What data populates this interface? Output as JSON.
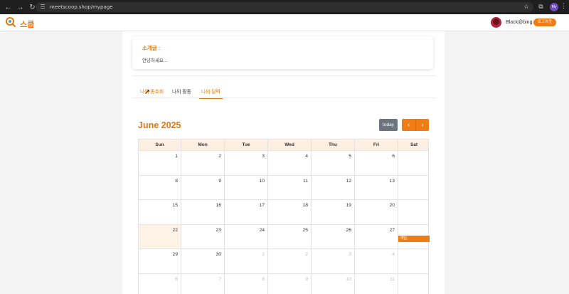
{
  "browser": {
    "url": "meetscoop.shop/mypage",
    "profile_initials": "My"
  },
  "header": {
    "logo_text": "스쿱",
    "username": "Black@bing",
    "logout_label": "로그아웃"
  },
  "intro": {
    "label": "소개글 :",
    "text": "안녕하세요..."
  },
  "tabs": [
    {
      "label": "나의 동호회",
      "active": false
    },
    {
      "label": "나의 활동",
      "active": false
    },
    {
      "label": "나의 달력",
      "active": true
    }
  ],
  "calendar": {
    "title": "June 2025",
    "today_label": "today",
    "prev_icon": "‹",
    "next_icon": "›",
    "weekdays": [
      "Sun",
      "Mon",
      "Tue",
      "Wed",
      "Thu",
      "Fri",
      "Sat"
    ],
    "weeks": [
      [
        {
          "d": "1"
        },
        {
          "d": "2"
        },
        {
          "d": "3"
        },
        {
          "d": "4"
        },
        {
          "d": "5"
        },
        {
          "d": "6"
        },
        {
          "d": ""
        }
      ],
      [
        {
          "d": "8"
        },
        {
          "d": "9"
        },
        {
          "d": "10"
        },
        {
          "d": "11"
        },
        {
          "d": "12"
        },
        {
          "d": "13"
        },
        {
          "d": ""
        }
      ],
      [
        {
          "d": "15"
        },
        {
          "d": "16"
        },
        {
          "d": "17"
        },
        {
          "d": "18"
        },
        {
          "d": "19"
        },
        {
          "d": "20"
        },
        {
          "d": ""
        }
      ],
      [
        {
          "d": "22",
          "today": true
        },
        {
          "d": "23"
        },
        {
          "d": "24"
        },
        {
          "d": "25"
        },
        {
          "d": "26"
        },
        {
          "d": "27"
        },
        {
          "d": "",
          "event": "게임"
        }
      ],
      [
        {
          "d": "29"
        },
        {
          "d": "30"
        },
        {
          "d": "1",
          "other": true
        },
        {
          "d": "2",
          "other": true
        },
        {
          "d": "3",
          "other": true
        },
        {
          "d": "4",
          "other": true
        },
        {
          "d": ""
        }
      ],
      [
        {
          "d": "6",
          "other": true
        },
        {
          "d": "7",
          "other": true
        },
        {
          "d": "8",
          "other": true
        },
        {
          "d": "9",
          "other": true
        },
        {
          "d": "10",
          "other": true
        },
        {
          "d": "11",
          "other": true
        },
        {
          "d": ""
        }
      ]
    ]
  },
  "colors": {
    "accent": "#ef7c14",
    "today_bg": "#fdf3e7"
  }
}
